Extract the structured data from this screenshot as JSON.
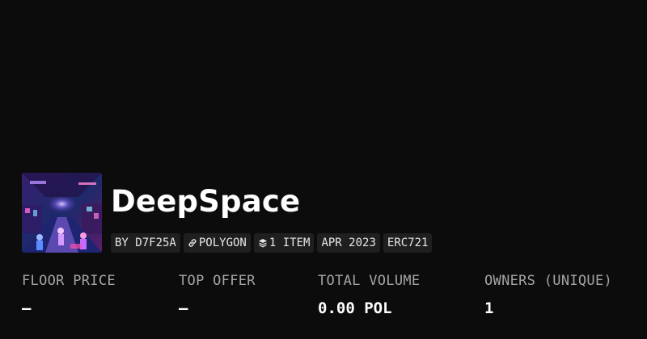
{
  "collection": {
    "title": "DeepSpace",
    "tags": {
      "creator": "BY D7F25A",
      "chain": "POLYGON",
      "items": "1 ITEM",
      "date": "APR 2023",
      "standard": "ERC721"
    }
  },
  "stats": {
    "floor_price": {
      "label": "FLOOR PRICE",
      "value": "—"
    },
    "top_offer": {
      "label": "TOP OFFER",
      "value": "—"
    },
    "total_volume": {
      "label": "TOTAL VOLUME",
      "value": "0.00 POL"
    },
    "owners": {
      "label": "OWNERS (UNIQUE)",
      "value": "1"
    }
  },
  "icons": {
    "chain": "link-icon",
    "items": "layers-icon"
  },
  "colors": {
    "background": "#0c0c0c",
    "tag_background": "#1f1f1f",
    "label": "#a3a3a3",
    "value": "#ffffff"
  }
}
